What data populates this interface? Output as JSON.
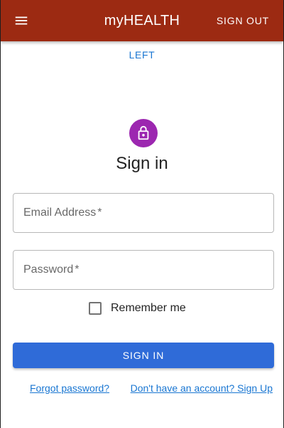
{
  "colors": {
    "appbar_bg": "#9c2a12",
    "avatar_bg": "#9c27b0",
    "primary_button_bg": "#2f6bd8",
    "link": "#1976d2"
  },
  "appbar": {
    "menu_icon": "menu-icon",
    "title": "myHEALTH",
    "signout_label": "SIGN OUT"
  },
  "nav": {
    "left_link": "LEFT"
  },
  "signin": {
    "avatar_icon": "lock-icon",
    "heading": "Sign in",
    "email_label": "Email Address",
    "password_label": "Password",
    "required_marker": "*",
    "remember_label": "Remember me",
    "remember_checked": false,
    "submit_label": "SIGN IN",
    "forgot_link": "Forgot password?",
    "signup_link": "Don't have an account? Sign Up"
  }
}
